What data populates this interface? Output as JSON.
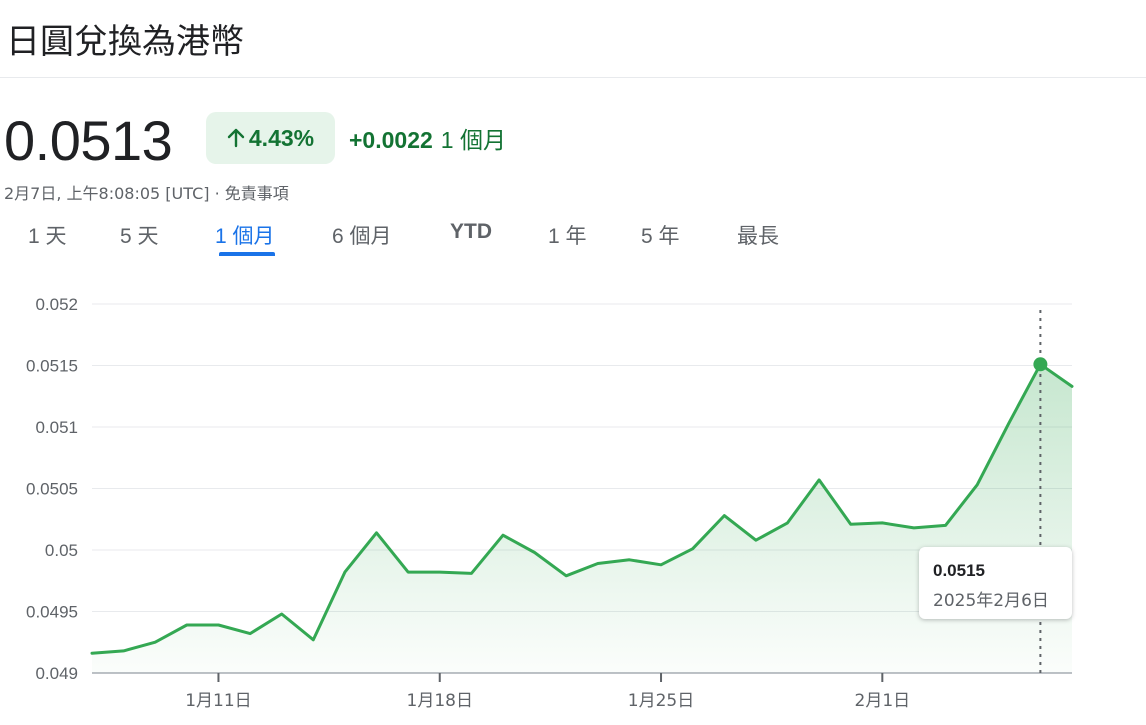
{
  "header": {
    "title": "日圓兌換為港幣"
  },
  "quote": {
    "price": "0.0513",
    "change_pct": "4.43%",
    "change_abs": "+0.0022",
    "change_period": "1 個月",
    "timestamp": "2月7日, 上午8:08:05 [UTC]",
    "separator": " · ",
    "disclaimer": "免責事項",
    "positive_color": "#137333",
    "badge_bg": "#e6f4ea"
  },
  "tabs": [
    {
      "label": "1 天",
      "active": false
    },
    {
      "label": "5 天",
      "active": false
    },
    {
      "label": "1 個月",
      "active": true
    },
    {
      "label": "6 個月",
      "active": false
    },
    {
      "label": "YTD",
      "active": false
    },
    {
      "label": "1 年",
      "active": false
    },
    {
      "label": "5 年",
      "active": false
    },
    {
      "label": "最長",
      "active": false
    }
  ],
  "tooltip": {
    "value": "0.0515",
    "date": "2025年2月6日"
  },
  "chart_data": {
    "type": "area",
    "line_color": "#34a853",
    "ylim": [
      0.049,
      0.052
    ],
    "y_ticks": [
      "0.052",
      "0.0515",
      "0.051",
      "0.0505",
      "0.05",
      "0.0495",
      "0.049"
    ],
    "y_tick_values": [
      0.052,
      0.0515,
      0.051,
      0.0505,
      0.05,
      0.0495,
      0.049
    ],
    "x_ticks": [
      "1月11日",
      "1月18日",
      "1月25日",
      "2月1日"
    ],
    "x_tick_values": [
      4,
      11,
      18,
      25
    ],
    "x_range": [
      0,
      31
    ],
    "x": [
      0,
      1,
      2,
      3,
      4,
      5,
      6,
      7,
      8,
      9,
      10,
      11,
      12,
      13,
      14,
      15,
      16,
      17,
      18,
      19,
      20,
      21,
      22,
      23,
      24,
      25,
      26,
      27,
      28,
      29,
      30,
      31
    ],
    "values": [
      0.04916,
      0.04918,
      0.04925,
      0.04939,
      0.04939,
      0.04932,
      0.04948,
      0.04927,
      0.04982,
      0.05014,
      0.04982,
      0.04982,
      0.04981,
      0.05012,
      0.04998,
      0.04979,
      0.04989,
      0.04992,
      0.04988,
      0.05001,
      0.05028,
      0.05008,
      0.05022,
      0.05057,
      0.05021,
      0.05022,
      0.05018,
      0.0502,
      0.05053,
      0.05103,
      0.05151,
      0.05133
    ],
    "highlight_index": 30
  }
}
